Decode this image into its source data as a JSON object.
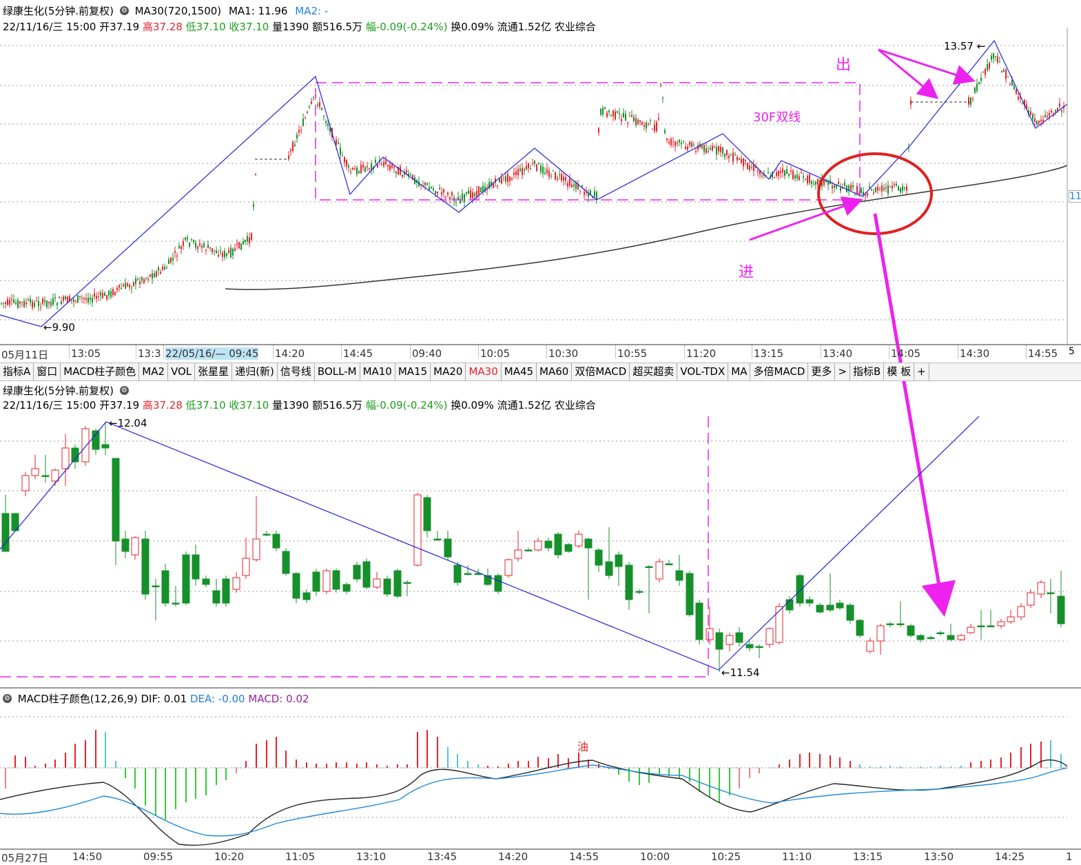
{
  "stock": {
    "name": "绿康生化(5分钟.前复权)",
    "ma_line_1": "MA30(720,1500)",
    "ma1_value": "MA1: 11.96",
    "ma2_value": "MA2: -"
  },
  "quote": {
    "date": "22/11/16/三 15:00",
    "open": "开37.19",
    "high": "高37.28",
    "low": "低37.10",
    "close": "收37.10",
    "volume": "量1390",
    "amount": "额516.5万",
    "change": "幅-0.09(-0.24%)",
    "turnover": "换0.09%",
    "float": "流通1.52亿",
    "sector": "农业综合"
  },
  "top_panel": {
    "time_labels": [
      "05月11日",
      "13:05",
      "13:3",
      "22/05/16/— 09:45",
      "14:20",
      "14:45",
      "09:40",
      "10:05",
      "10:30",
      "10:55",
      "11:20",
      "13:15",
      "13:40",
      "14:05",
      "14:30",
      "14:55"
    ],
    "right_edge_label": "5",
    "price_tag": "11",
    "annotations": {
      "low_price": "9.90",
      "high_price": "13.57",
      "box_label": "30F双线",
      "exit_label": "出",
      "enter_label": "进"
    }
  },
  "tabs": [
    "指标A",
    "窗口",
    "MACD柱子颜色",
    "MA2",
    "VOL",
    "张星星",
    "递归(新)",
    "信号线",
    "BOLL-M",
    "MA10",
    "MA15",
    "MA20",
    "MA30",
    "MA45",
    "MA60",
    "双倍MACD",
    "超买超卖",
    "VOL-TDX",
    "MA",
    "多倍MACD",
    "更多",
    ">",
    "指标B",
    "模 板",
    "+"
  ],
  "active_tab": "MA30",
  "middle_panel": {
    "annotations": {
      "high_price": "12.04",
      "low_price": "11.54"
    }
  },
  "macd_panel": {
    "title": "MACD柱子颜色(12,26,9)",
    "dif": "DIF: 0.01",
    "dea": "DEA: -0.00",
    "macd": "MACD: 0.02",
    "marker": "油",
    "time_labels": [
      "05月27日",
      "14:50",
      "09:55",
      "10:20",
      "11:05",
      "13:10",
      "13:45",
      "14:20",
      "14:55",
      "10:00",
      "10:25",
      "11:10",
      "13:15",
      "13:50",
      "14:25",
      "1"
    ]
  },
  "colors": {
    "up": "#e8202a",
    "down": "#16902a",
    "trendline": "#2020e0",
    "annotation": "#ee22ee",
    "ma_line": "#333333",
    "dea_line": "#1f8ad8",
    "macd_pos": "#e8202a",
    "macd_pos_weak": "#4ac8d8",
    "macd_neg": "#33cc33"
  },
  "chart_data": [
    {
      "type": "candlestick",
      "panel": "top",
      "x": [
        "05月11日",
        "13:05",
        "13:3",
        "22/05/16 09:45",
        "14:20",
        "14:45",
        "09:40",
        "10:05",
        "10:30",
        "10:55",
        "11:20",
        "13:15",
        "13:40",
        "14:05",
        "14:30",
        "14:55"
      ],
      "trend_points": [
        9.9,
        12.4,
        11.2,
        11.5,
        11.0,
        11.6,
        11.1,
        11.9,
        11.4,
        11.2,
        13.57,
        12.3,
        12.6
      ],
      "series": [
        {
          "name": "MA30(720,1500)",
          "approx_values": [
            10.2,
            10.35,
            10.6,
            10.9,
            11.25,
            11.55
          ]
        }
      ],
      "ylim": [
        9.7,
        13.8
      ]
    },
    {
      "type": "candlestick",
      "panel": "middle",
      "trend_points": [
        11.7,
        12.04,
        11.54,
        12.15
      ],
      "ylim": [
        11.45,
        12.15
      ]
    },
    {
      "type": "bar",
      "panel": "macd",
      "series": [
        {
          "name": "DIF",
          "value": 0.01
        },
        {
          "name": "DEA",
          "value": -0.0
        },
        {
          "name": "MACD",
          "value": 0.02
        }
      ]
    }
  ]
}
